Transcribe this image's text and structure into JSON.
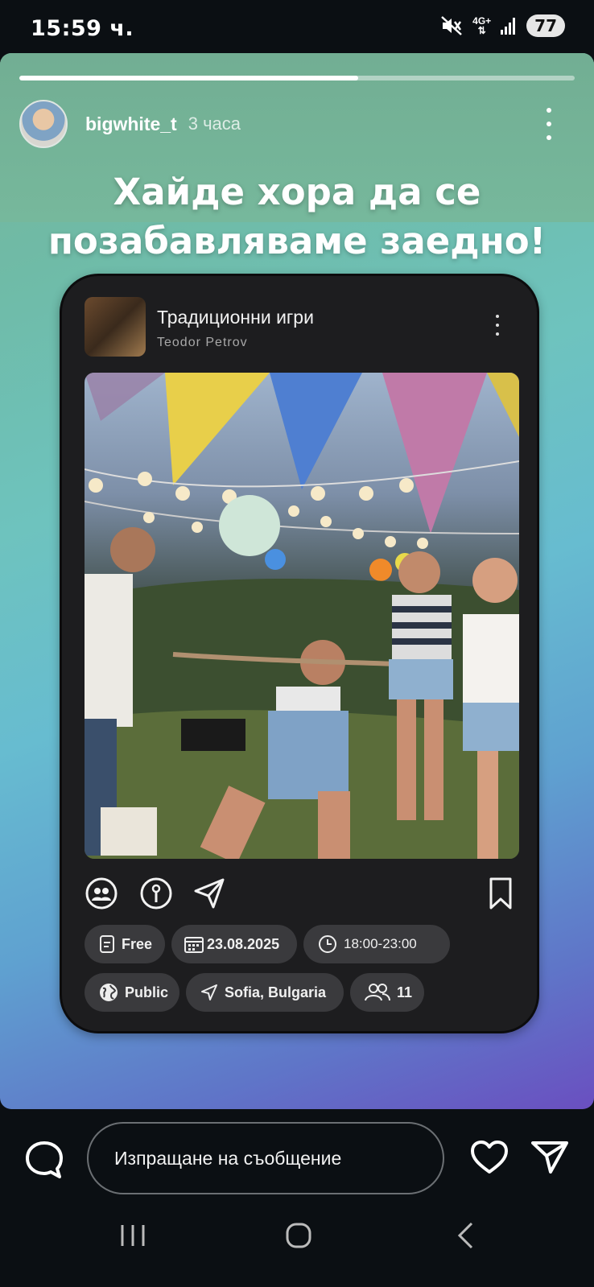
{
  "status_bar": {
    "time": "15:59 ч.",
    "network": "4G+",
    "battery": "77"
  },
  "story": {
    "progress": 0.61,
    "username": "bigwhite_t",
    "time_ago": "3 часа",
    "caption_line1": "Хайде хора да се",
    "caption_line2": "позабавляваме заедно!"
  },
  "event_card": {
    "title": "Традиционни игри",
    "author": "Teodor Petrov",
    "chips": {
      "price": "Free",
      "date": "23.08.2025",
      "time": "18:00-23:00",
      "visibility": "Public",
      "location": "Sofia, Bulgaria",
      "attendees": "11"
    }
  },
  "reply_bar": {
    "placeholder": "Изпращане на съобщение"
  },
  "icons": {
    "mute": "mute-icon",
    "signal": "signal-icon",
    "comment": "comment-icon",
    "heart": "heart-icon",
    "send": "send-icon",
    "recents": "recents-icon",
    "home": "home-icon",
    "back": "back-icon"
  }
}
